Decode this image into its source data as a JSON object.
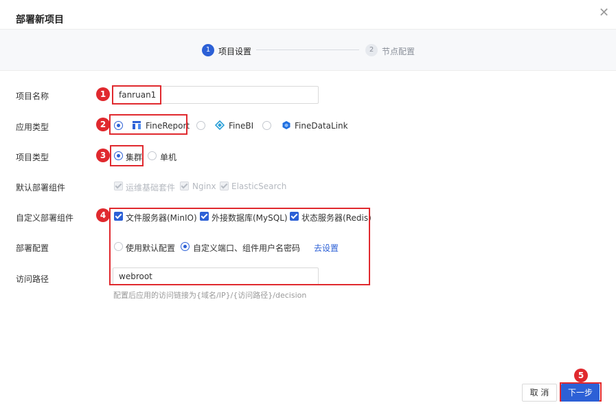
{
  "dialog": {
    "title": "部署新项目"
  },
  "steps": [
    {
      "number": "1",
      "label": "项目设置"
    },
    {
      "number": "2",
      "label": "节点配置"
    }
  ],
  "form": {
    "project_name": {
      "label": "项目名称",
      "value": "fanruan1"
    },
    "app_type": {
      "label": "应用类型",
      "options": [
        "FineReport",
        "FineBI",
        "FineDataLink"
      ],
      "selected": "FineReport"
    },
    "project_type": {
      "label": "项目类型",
      "options": [
        "集群",
        "单机"
      ],
      "selected": "集群"
    },
    "default_components": {
      "label": "默认部署组件",
      "options": [
        "运维基础套件",
        "Nginx",
        "ElasticSearch"
      ]
    },
    "custom_components": {
      "label": "自定义部署组件",
      "options": [
        "文件服务器(MinIO)",
        "外接数据库(MySQL)",
        "状态服务器(Redis)"
      ]
    },
    "deploy_config": {
      "label": "部署配置",
      "options": [
        "使用默认配置",
        "自定义端口、组件用户名密码"
      ],
      "selected": "自定义端口、组件用户名密码",
      "link": "去设置"
    },
    "access_path": {
      "label": "访问路径",
      "value": "webroot",
      "hint": "配置后应用的访问链接为{域名/IP}/{访问路径}/decision"
    }
  },
  "markers": [
    "1",
    "2",
    "3",
    "4",
    "5"
  ],
  "buttons": {
    "cancel": "取 消",
    "next": "下一步"
  },
  "icons": {
    "close": "close-icon",
    "finereport": "finereport-logo-icon",
    "finebi": "finebi-logo-icon",
    "finedatalink": "finedatalink-logo-icon"
  },
  "colors": {
    "primary": "#2c60d6",
    "annotation_red": "#e0292e"
  }
}
